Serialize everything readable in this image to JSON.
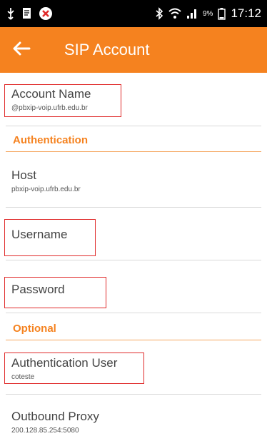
{
  "status_bar": {
    "battery": "9%",
    "time": "17:12"
  },
  "app_bar": {
    "title": "SIP Account"
  },
  "account": {
    "label": "Account Name",
    "value": "@pbxip-voip.ufrb.edu.br"
  },
  "sections": {
    "authentication": "Authentication",
    "optional": "Optional"
  },
  "host": {
    "label": "Host",
    "value": "pbxip-voip.ufrb.edu.br"
  },
  "username": {
    "label": "Username"
  },
  "password": {
    "label": "Password"
  },
  "auth_user": {
    "label": "Authentication User",
    "value": "coteste"
  },
  "proxy": {
    "label": "Outbound Proxy",
    "value": "200.128.85.254:5080"
  },
  "colors": {
    "accent": "#f5821f",
    "highlight": "#e02b2b"
  }
}
